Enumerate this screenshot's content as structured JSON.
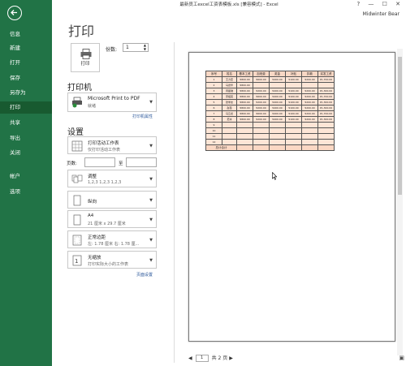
{
  "window": {
    "title": "最新员工excel工资表模板.xls [兼容模式] - Excel",
    "controls": "? — ☐ ✕",
    "user": "Midwinter Bear"
  },
  "sidebar": {
    "items": [
      {
        "label": "信息"
      },
      {
        "label": "新建"
      },
      {
        "label": "打开"
      },
      {
        "label": "保存"
      },
      {
        "label": "另存为"
      },
      {
        "label": "打印",
        "active": true
      },
      {
        "label": "共享"
      },
      {
        "label": "导出"
      },
      {
        "label": "关闭"
      },
      {
        "label": "帐户"
      },
      {
        "label": "选项"
      }
    ]
  },
  "print": {
    "title": "打印",
    "button": "打印",
    "copies_label": "份数:",
    "copies": "1"
  },
  "printer": {
    "heading": "打印机",
    "name": "Microsoft Print to PDF",
    "status": "就绪",
    "props_link": "打印机属性",
    "info": "ⓘ"
  },
  "settings": {
    "heading": "设置",
    "active_sheets": {
      "main": "打印活动工作表",
      "sub": "仅打印活动工作表"
    },
    "pages_label": "页数:",
    "to_label": "至",
    "collate": {
      "main": "调整",
      "sub": "1,2,3    1,2,3    1,2,3"
    },
    "orientation": {
      "main": "纵向"
    },
    "paper": {
      "main": "A4",
      "sub": "21 厘米 x 29.7 厘米"
    },
    "margins": {
      "main": "正常边距",
      "sub": "左: 1.78 厘米    右: 1.78 厘..."
    },
    "scaling": {
      "main": "无缩放",
      "sub": "打印实际大小的工作表"
    },
    "page_setup_link": "页面设置"
  },
  "preview": {
    "headers": [
      "序号",
      "姓名",
      "基本工资",
      "加班费",
      "奖金",
      "补贴",
      "扣款",
      "实发工资"
    ],
    "rows": [
      [
        "1",
        "王力宏",
        "¥800.00",
        "¥600.00",
        "¥400.00",
        "¥100.00",
        "¥200.00",
        "¥1,700.00"
      ],
      [
        "2",
        "马德华",
        "¥800.00",
        "",
        "",
        "",
        "",
        ""
      ],
      [
        "3",
        "周星驰",
        "¥800.00",
        "¥200.00",
        "¥400.00",
        "¥100.00",
        "¥200.00",
        "¥1,300.00"
      ],
      [
        "4",
        "宋祖英",
        "¥800.00",
        "¥600.00",
        "¥400.00",
        "¥100.00",
        "¥200.00",
        "¥1,700.00"
      ],
      [
        "5",
        "张学友",
        "¥800.00",
        "¥200.00",
        "¥400.00",
        "¥100.00",
        "¥200.00",
        "¥1,300.00"
      ],
      [
        "6",
        "赵薇",
        "¥800.00",
        "¥200.00",
        "¥400.00",
        "¥100.00",
        "¥200.00",
        "¥1,300.00"
      ],
      [
        "7",
        "马云龙",
        "¥800.00",
        "¥600.00",
        "¥400.00",
        "¥100.00",
        "¥200.00",
        "¥1,700.00"
      ],
      [
        "8",
        "范冰",
        "¥800.00",
        "¥200.00",
        "¥400.00",
        "¥100.00",
        "¥200.00",
        "¥1,300.00"
      ],
      [
        "9",
        "",
        "",
        "",
        "",
        "",
        "",
        ""
      ],
      [
        "10",
        "",
        "",
        "",
        "",
        "",
        "",
        ""
      ],
      [
        "11",
        "",
        "",
        "",
        "",
        "",
        "",
        ""
      ],
      [
        "12",
        "",
        "",
        "",
        "",
        "",
        "",
        ""
      ]
    ],
    "total_label": "总计合计"
  },
  "pager": {
    "current": "1",
    "total": "共 2 页",
    "prev": "◀",
    "next": "▶"
  }
}
